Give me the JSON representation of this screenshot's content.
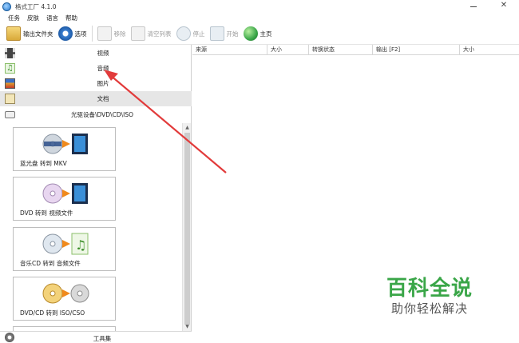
{
  "window": {
    "title": "格式工厂 4.1.0",
    "close_glyph": "✕"
  },
  "menu": [
    "任务",
    "皮肤",
    "语言",
    "帮助"
  ],
  "toolbar": {
    "output_folder": "输出文件夹",
    "options": "选项",
    "remove": "移除",
    "clear_list": "清空列表",
    "stop": "停止",
    "start": "开始",
    "home": "主页"
  },
  "categories": {
    "video": "视频",
    "audio": "音频",
    "picture": "图片",
    "document": "文档",
    "disc": "光驱设备\\DVD\\CD\\ISO"
  },
  "tools": [
    {
      "label": "蓝光盘 转到 MKV",
      "icon": "bluray-to-mkv-icon"
    },
    {
      "label": "DVD 转到 视频文件",
      "icon": "dvd-to-video-icon"
    },
    {
      "label": "音乐CD 转到 音频文件",
      "icon": "cd-to-audio-icon"
    },
    {
      "label": "DVD/CD 转到 ISO/CSO",
      "icon": "disc-to-iso-icon"
    }
  ],
  "bottom": {
    "toolbox": "工具集"
  },
  "scroll": {
    "up": "▲",
    "down": "▼"
  },
  "file_list": {
    "columns": [
      "来源",
      "大小",
      "转换状态",
      "输出 [F2]",
      "大小"
    ]
  },
  "watermark": {
    "big": "百科全说",
    "small": "助你轻松解决"
  },
  "colors": {
    "watermark_green": "#3aa648",
    "arrow_red": "#e23b3b",
    "selected_row": "#e6e6e6"
  }
}
